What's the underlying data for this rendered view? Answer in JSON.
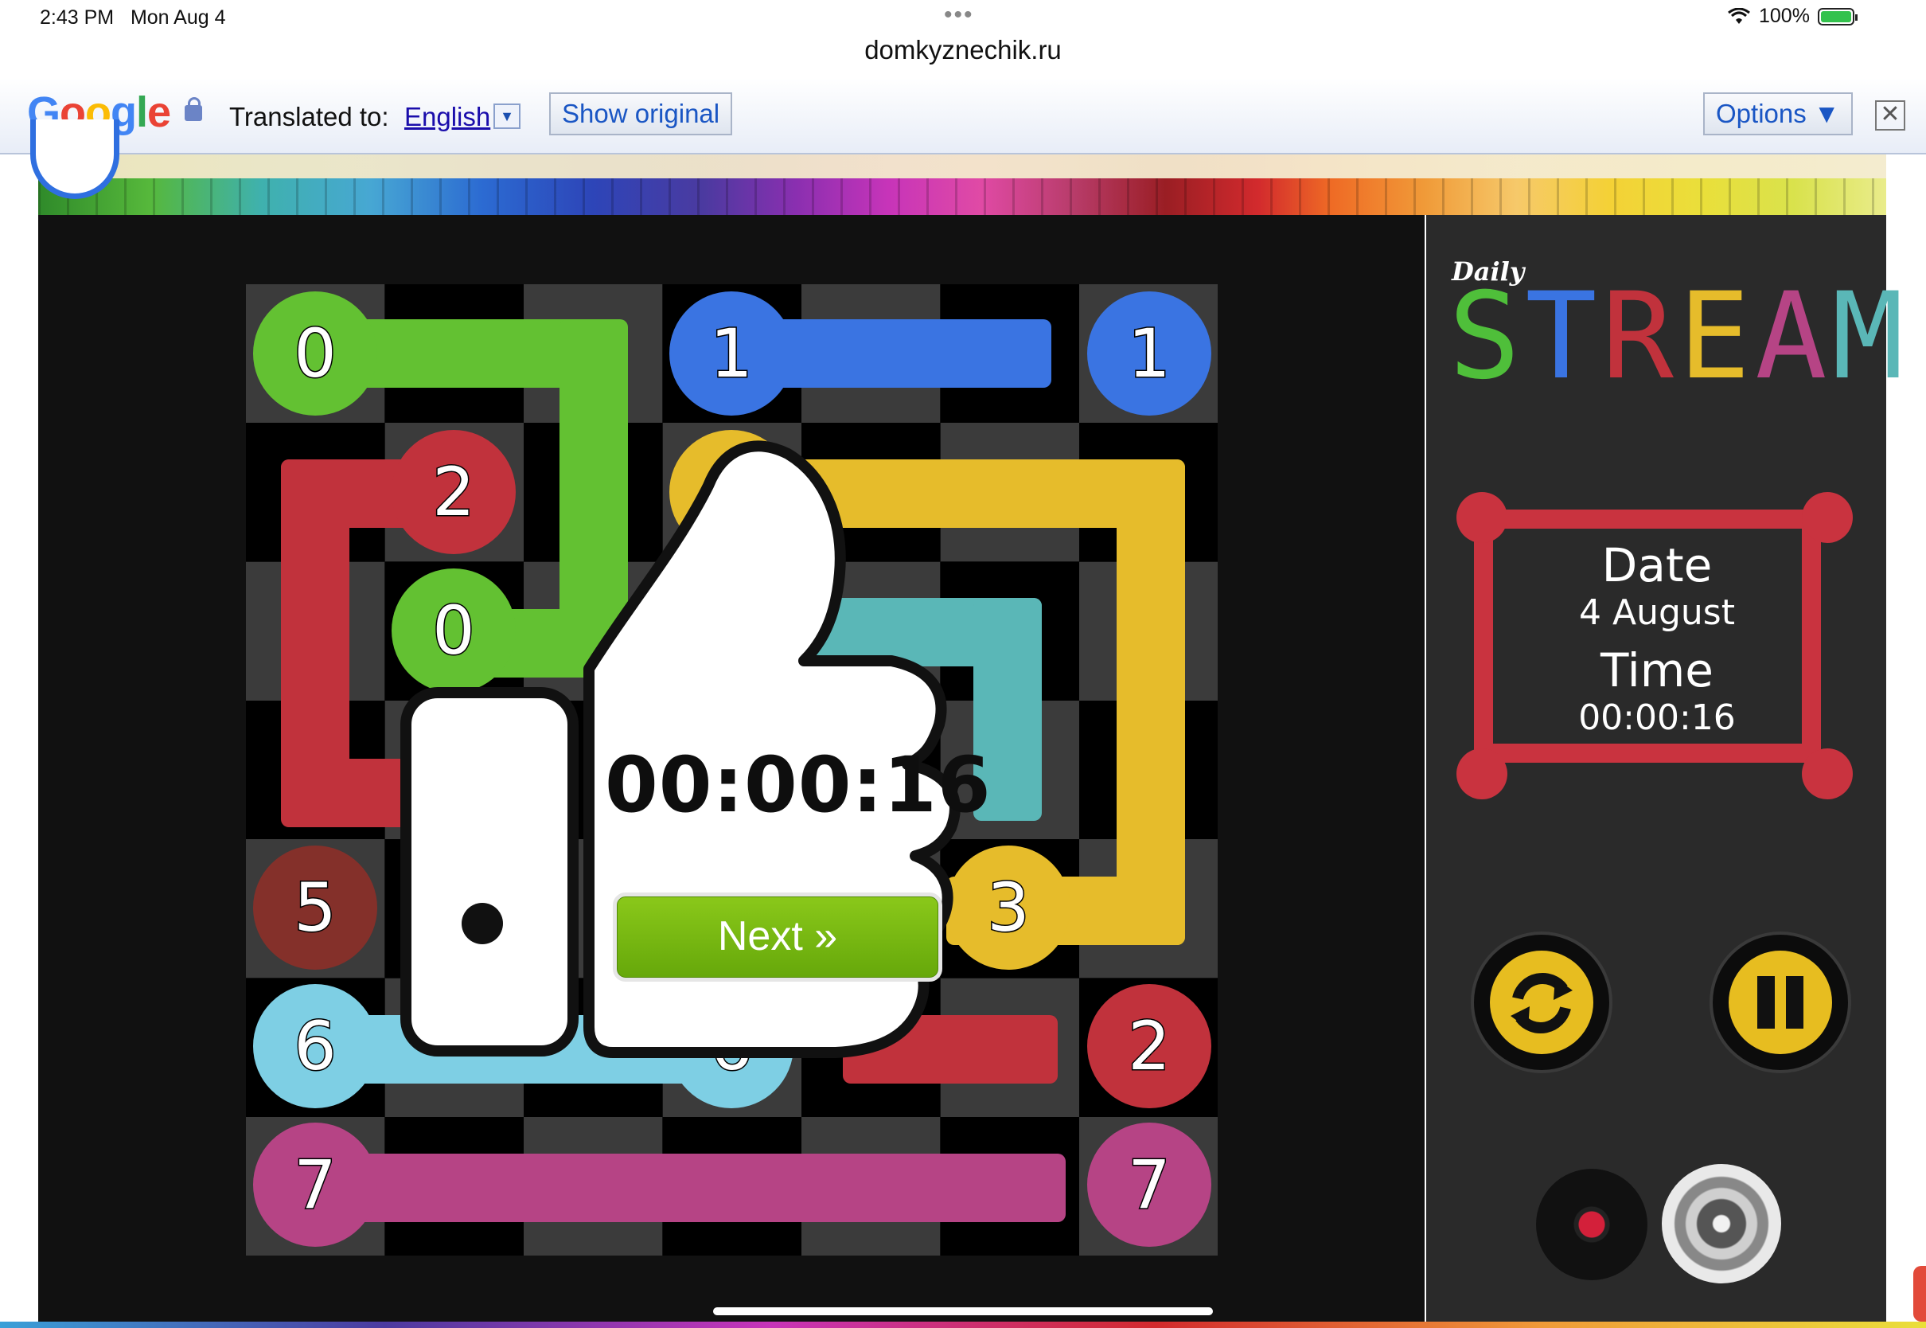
{
  "status_bar": {
    "time": "2:43 PM",
    "date": "Mon Aug 4",
    "battery": "100%",
    "url": "domkyznechik.ru"
  },
  "translate_bar": {
    "logo": "Google",
    "translated_label": "Translated to:",
    "language": "English",
    "show_original": "Show original",
    "options": "Options ▼",
    "close": "✕"
  },
  "game": {
    "title_small": "Daily",
    "title": "STREAM",
    "date_label": "Date",
    "date_value": "4 August",
    "time_label": "Time",
    "time_value": "00:00:16",
    "overlay_time": "00:00:16",
    "next_label": "Next »",
    "colors": {
      "green": "#63c132",
      "blue": "#3a74e2",
      "red": "#c1323c",
      "yellow": "#e6bc2b",
      "teal": "#5ab7b7",
      "brown": "#84302a",
      "lightblue": "#7ecfe4",
      "magenta": "#b64485"
    },
    "nodes": [
      {
        "label": "0",
        "color": "green"
      },
      {
        "label": "1",
        "color": "blue"
      },
      {
        "label": "1",
        "color": "blue"
      },
      {
        "label": "2",
        "color": "red"
      },
      {
        "label": "3",
        "color": "yellow"
      },
      {
        "label": "0",
        "color": "green"
      },
      {
        "label": "5",
        "color": "brown"
      },
      {
        "label": "3",
        "color": "yellow"
      },
      {
        "label": "6",
        "color": "lightblue"
      },
      {
        "label": "6",
        "color": "lightblue"
      },
      {
        "label": "2",
        "color": "red"
      },
      {
        "label": "7",
        "color": "magenta"
      },
      {
        "label": "7",
        "color": "magenta"
      }
    ]
  }
}
